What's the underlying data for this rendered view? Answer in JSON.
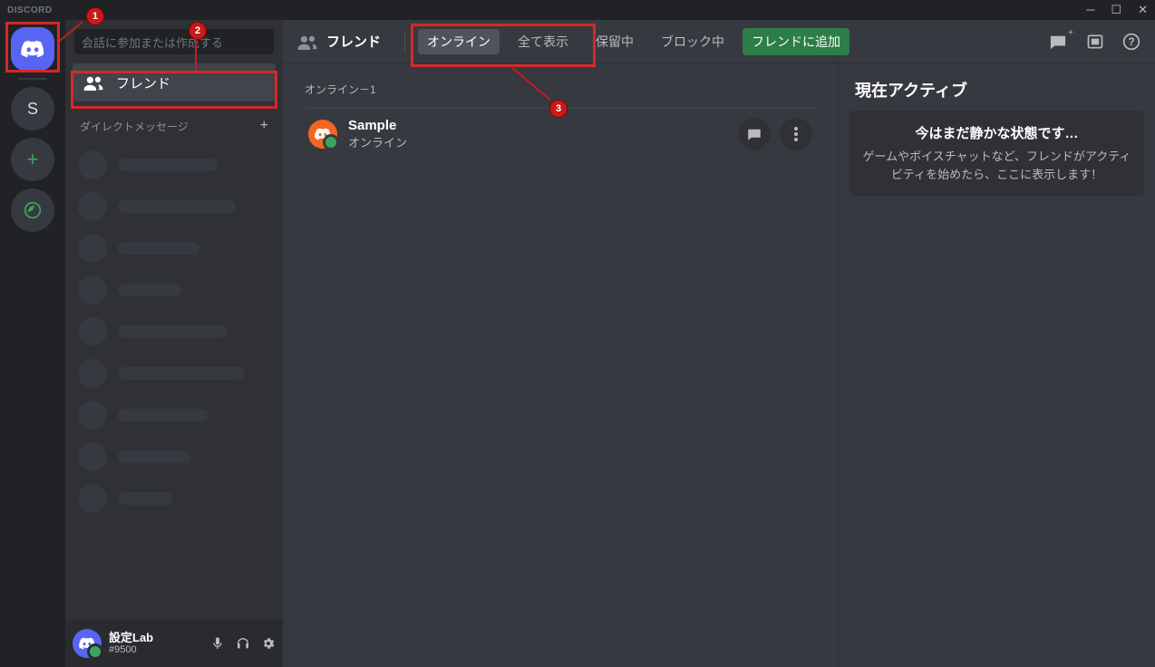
{
  "titlebar": {
    "logo": "DISCORD"
  },
  "server_rail": {
    "server_initial": "S"
  },
  "sidebar": {
    "search_placeholder": "会話に参加または作成する",
    "friends_label": "フレンド",
    "dm_header": "ダイレクトメッセージ"
  },
  "user": {
    "name": "設定Lab",
    "tag": "#9500"
  },
  "topbar": {
    "title": "フレンド",
    "tabs": {
      "online": "オンライン",
      "all": "全て表示",
      "pending": "保留中",
      "blocked": "ブロック中",
      "add": "フレンドに追加"
    }
  },
  "friends": {
    "section_label": "オンライン－1",
    "items": [
      {
        "name": "Sample",
        "status": "オンライン"
      }
    ]
  },
  "activity": {
    "title": "現在アクティブ",
    "empty_title": "今はまだ静かな状態です…",
    "empty_body": "ゲームやボイスチャットなど、フレンドがアクティビティを始めたら、ここに表示します！"
  },
  "annotations": {
    "n1": "1",
    "n2": "2",
    "n3": "3"
  }
}
